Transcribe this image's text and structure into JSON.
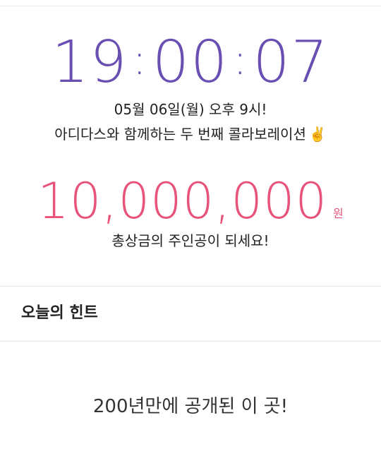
{
  "countdown": {
    "hours": "19",
    "minutes": "00",
    "seconds": "07",
    "separator": ":",
    "color": "#6a4fb3"
  },
  "event": {
    "date_line": "05월 06일(월) 오후 9시!",
    "description": "아디다스와 함께하는 두 번째 콜라보레이션",
    "emoji": "✌️"
  },
  "prize": {
    "amount": "10,000,000",
    "unit": "원",
    "color": "#e8537a",
    "caption": "총상금의 주인공이 되세요!"
  },
  "hint": {
    "title": "오늘의 힌트",
    "text": "200년만에 공개된 이 곳!"
  }
}
